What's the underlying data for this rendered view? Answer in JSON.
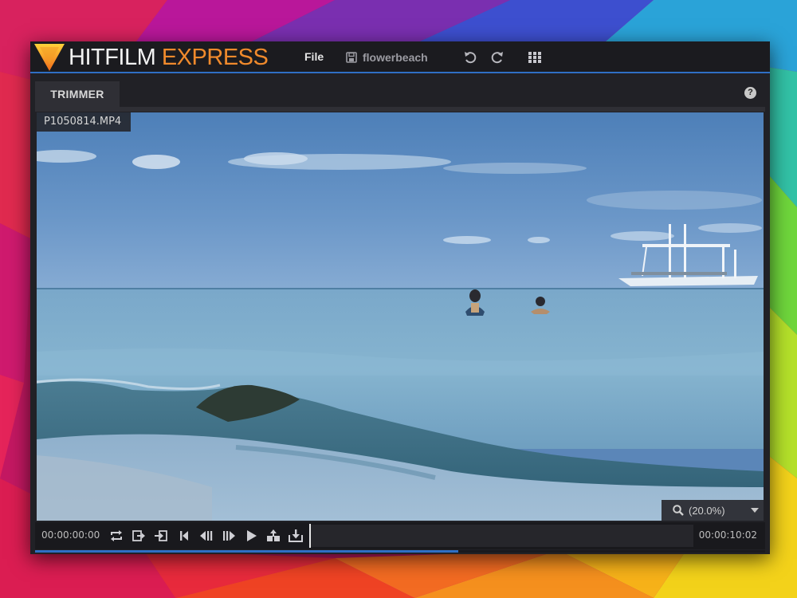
{
  "app": {
    "brand_primary": "HITFILM",
    "brand_secondary": "EXPRESS",
    "menu_file": "File",
    "project_name": "flowerbeach",
    "accent_color": "#2f6fc4",
    "brand_color": "#f08a2c"
  },
  "toolbar": {
    "icons": [
      "save-icon",
      "undo-icon",
      "redo-icon",
      "grid-icon"
    ]
  },
  "panel": {
    "tab_label": "TRIMMER",
    "help_label": "?"
  },
  "viewer": {
    "clip_name": "P1050814.MP4",
    "zoom_label": "(20.0%)"
  },
  "transport": {
    "in_timecode": "00:00:00:00",
    "out_timecode": "00:00:10:02",
    "playhead_fraction": 0.0,
    "icons": [
      "loop-icon",
      "insert-icon",
      "overlay-icon",
      "go-to-start-icon",
      "step-back-icon",
      "step-forward-icon",
      "play-icon",
      "set-in-out-icon",
      "export-icon"
    ]
  },
  "timeline": {
    "progress_fraction": 0.58
  }
}
